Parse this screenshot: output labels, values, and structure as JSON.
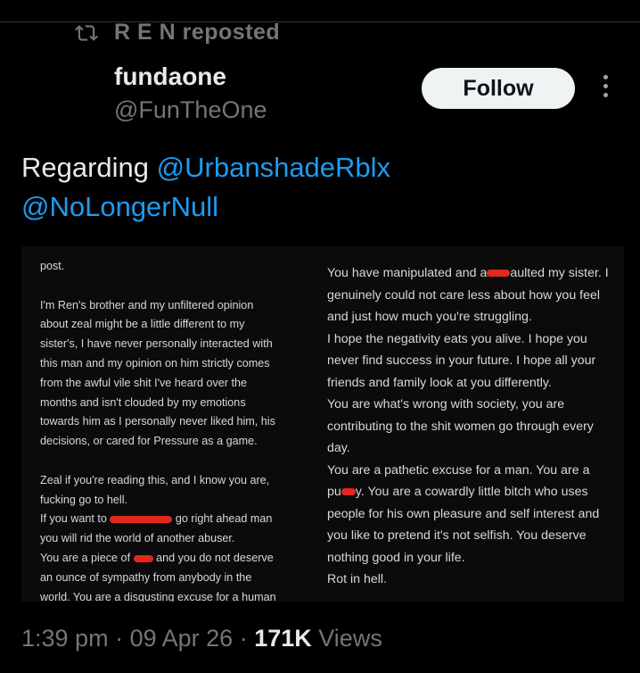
{
  "repost": {
    "label": "R E N reposted"
  },
  "author": {
    "display_name": "fundaone",
    "handle": "@FunTheOne"
  },
  "follow_label": "Follow",
  "tweet": {
    "prefix": "Regarding",
    "mention1": "@UrbanshadeRblx",
    "mention2": "@NoLongerNull"
  },
  "media": {
    "left": {
      "line0": "post.",
      "line1": "I'm Ren's brother and my unfiltered opinion",
      "line2": "about zeal might be a little different to my",
      "line3": "sister's, I have never personally interacted with",
      "line4": "this man and my opinion on him strictly comes",
      "line5": "from the awful vile shit I've heard over the",
      "line6": "months and isn't clouded by my emotions",
      "line7": "towards him as I personally never liked him, his",
      "line8": "decisions, or cared for Pressure as a game.",
      "line9": "Zeal if you're reading this, and I know you are,",
      "line10": "fucking go to hell.",
      "line11a": "If you want to",
      "line11b": "go right ahead man",
      "line12": "you will rid the world of another abuser.",
      "line13a": "You are a piece of",
      "line13b": "and you do not deserve",
      "line14": "an ounce of sympathy from anybody in the",
      "line15": "world. You are a disgusting excuse for a human"
    },
    "right": {
      "line0a": "You have manipulated and a",
      "line0b": "aulted",
      "line0c": "my sister. I",
      "line1": "genuinely could not care less about how you feel",
      "line2": "and just how much you're struggling.",
      "line3": "I hope the negativity eats you alive. I hope you",
      "line4": "never find success in your future. I hope all your",
      "line5": "friends and family look at you differently.",
      "line6": "You are what's wrong with society, you are",
      "line7": "contributing to the shit women go through every",
      "line8": "day.",
      "line9": "You are a pathetic excuse for a man. You are a",
      "line10a": "pu",
      "line10b": "y. You are a cowardly little bitch who uses",
      "line11": "people for his own pleasure and self interest and",
      "line12": "you like to pretend it's not selfish. You deserve",
      "line13": "nothing good in your life.",
      "line14": "Rot in hell."
    }
  },
  "footer": {
    "time": "1:39 pm",
    "sep": "·",
    "date": "09 Apr 26",
    "views_count": "171K",
    "views_label": "Views"
  },
  "colors": {
    "accent": "#1d9bf0",
    "muted": "#71767b",
    "redaction": "#e0281f"
  }
}
